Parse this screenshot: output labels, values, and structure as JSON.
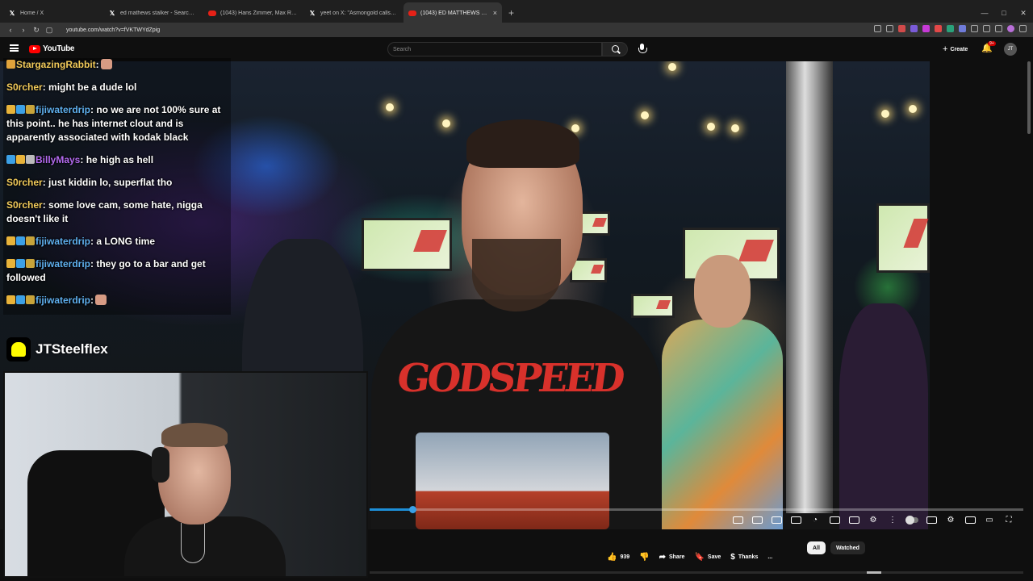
{
  "browser": {
    "tabs": [
      {
        "title": "Home / X",
        "icon": "x"
      },
      {
        "title": "ed mathews stalker - Search / X",
        "icon": "x"
      },
      {
        "title": "(1043) Hans Zimmer, Max Richter an...",
        "icon": "yt"
      },
      {
        "title": "yeet on X: \"Asmongold calls Clavicula...",
        "icon": "x"
      },
      {
        "title": "(1043) ED MATTHEWS FIGHT",
        "icon": "yt",
        "active": true
      }
    ],
    "new_tab": "+",
    "url": "youtube.com/watch?v=fVKTWYdZpig",
    "window_controls": [
      "—",
      "□",
      "✕"
    ]
  },
  "youtube": {
    "logo_text": "YouTube",
    "search_placeholder": "Search",
    "create_label": "Create",
    "notification_count": "9+",
    "avatar_initials": "JT"
  },
  "chat": {
    "messages": [
      {
        "user": "StargazingRabbit",
        "text": ":",
        "badges": [
          "#e0a33b"
        ],
        "emote": true,
        "color": "#f2cb5b"
      },
      {
        "user": "S0rcher",
        "text": ": might be a dude lol",
        "badges": [],
        "emote": false,
        "color": "#f2cb5b"
      },
      {
        "user": "fijiwaterdrip",
        "text": ": no we are not 100% sure at this point.. he has internet clout and is apparently associated with kodak black",
        "badges": [
          "#e8b33a",
          "#3ca0e6",
          "#c7a43b"
        ],
        "emote": false,
        "color": "#5fb0ef"
      },
      {
        "user": "BillyMays",
        "text": ": he high as hell",
        "badges": [
          "#3ca0e6",
          "#e8b33a",
          "#bbb"
        ],
        "emote": false,
        "color": "#b46bf0"
      },
      {
        "user": "S0rcher",
        "text": ": just kiddin lo, superflat tho",
        "badges": [],
        "emote": false,
        "color": "#f2cb5b"
      },
      {
        "user": "S0rcher",
        "text": ": some love cam, some hate, nigga doesn't like it",
        "badges": [],
        "emote": false,
        "color": "#f2cb5b"
      },
      {
        "user": "fijiwaterdrip",
        "text": ": a LONG time",
        "badges": [
          "#e8b33a",
          "#3ca0e6",
          "#c7a43b"
        ],
        "emote": false,
        "color": "#5fb0ef"
      },
      {
        "user": "fijiwaterdrip",
        "text": ": they go to a bar and get followed",
        "badges": [
          "#e8b33a",
          "#3ca0e6",
          "#c7a43b"
        ],
        "emote": false,
        "color": "#5fb0ef"
      },
      {
        "user": "fijiwaterdrip",
        "text": ":",
        "badges": [
          "#e8b33a",
          "#3ca0e6",
          "#c7a43b"
        ],
        "emote": true,
        "color": "#5fb0ef"
      }
    ]
  },
  "overlay": {
    "snapchat_handle": "JTSteelflex"
  },
  "video": {
    "shirt_text": "GODSPEED",
    "progress_percent": 6.5
  },
  "actions": {
    "likes": "939",
    "share": "Share",
    "save": "Save",
    "thanks": "Thanks",
    "more": "..."
  },
  "chips": [
    "All",
    "Watched"
  ],
  "colors": {
    "youtube_red": "#ff0000",
    "progress_blue": "#1d8fd8",
    "snap_yellow": "#fffc00"
  }
}
